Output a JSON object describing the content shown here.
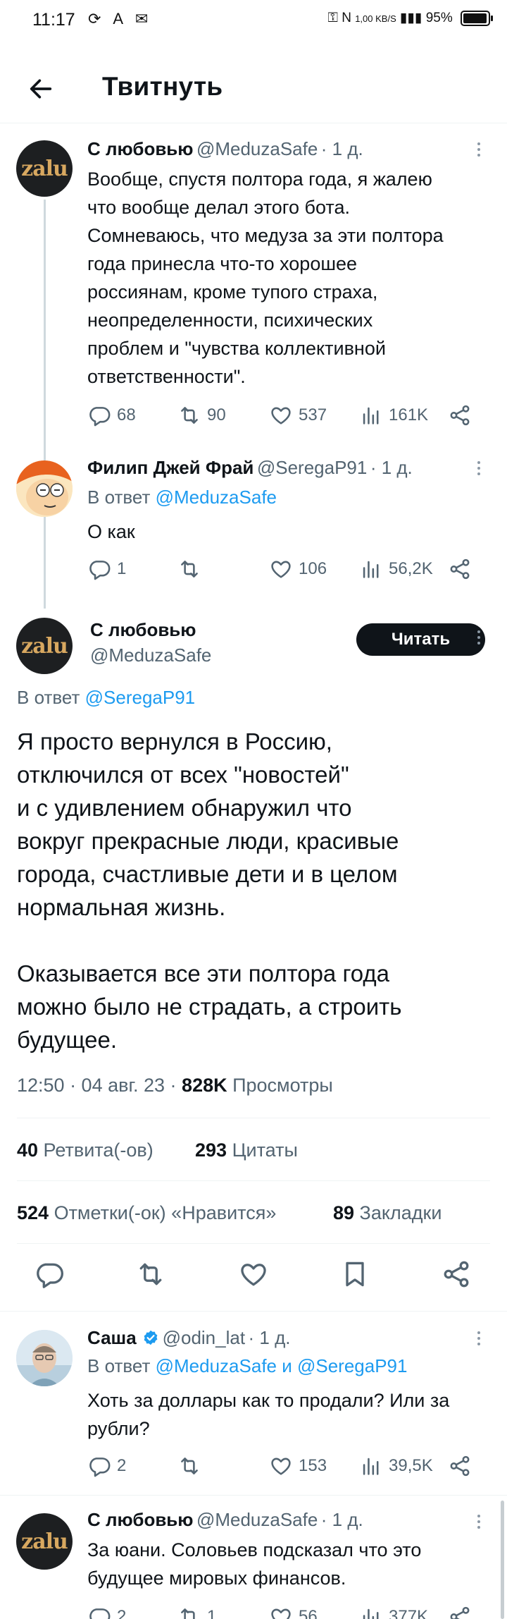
{
  "status_bar": {
    "time": "11:17",
    "speed": "1,00 KB/S",
    "battery": "95%"
  },
  "header": {
    "title": "Твитнуть"
  },
  "tweets": [
    {
      "name": "С любовью",
      "handle": "@MeduzaSafe",
      "time": "· 1 д.",
      "avatar_text": "zalu",
      "text": "Вообще, спустя полтора года, я жалею\nчто вообще делал этого бота.\nСомневаюсь, что медуза за эти полтора\nгода принесла что-то хорошее\nроссиянам, кроме тупого страха,\nнеопределенности, психических\nпроблем и \"чувства коллективной\nответственности\".",
      "replies": "68",
      "retweets": "90",
      "likes": "537",
      "views": "161K"
    },
    {
      "name": "Филип Джей Фрай",
      "handle": "@SeregaP91",
      "time": "· 1 д.",
      "reply_prefix": "В ответ ",
      "reply_to": "@MeduzaSafe",
      "text": "О как",
      "replies": "1",
      "retweets": "",
      "likes": "106",
      "views": "56,2K"
    }
  ],
  "main_tweet": {
    "name": "С любовью",
    "handle": "@MeduzaSafe",
    "avatar_text": "zalu",
    "follow_label": "Читать",
    "reply_prefix": "В ответ ",
    "reply_to": "@SeregaP91",
    "text": "Я просто вернулся в Россию,\nотключился от всех \"новостей\"\nи с удивлением обнаружил что\nвокруг прекрасные люди, красивые\nгорода, счастливые дети и в целом\nнормальная жизнь.\n\nОказывается все эти полтора года\nможно было не страдать, а строить\nбудущее.",
    "timestamp": "12:50 · 04 авг. 23 · ",
    "views_count": "828K",
    "views_label": " Просмотры",
    "retweets_count": "40",
    "retweets_label": " Ретвита(-ов)",
    "quotes_count": "293",
    "quotes_label": " Цитаты",
    "likes_count": "524",
    "likes_label": " Отметки(-ок) «Нравится»",
    "bookmarks_count": "89",
    "bookmarks_label": " Закладки"
  },
  "replies": [
    {
      "name": "Саша",
      "handle": "@odin_lat",
      "time": "· 1 д.",
      "reply_prefix": "В ответ ",
      "reply_to": "@MeduzaSafe и @SeregaP91",
      "text": "Хоть за доллары как то продали? Или за\nрубли?",
      "replies": "2",
      "retweets": "",
      "likes": "153",
      "views": "39,5K"
    },
    {
      "name": "С любовью",
      "handle": "@MeduzaSafe",
      "time": "· 1 д.",
      "avatar_text": "zalu",
      "text": "За юани. Соловьев подсказал что это\nбудущее мировых финансов.",
      "replies": "2",
      "retweets": "1",
      "likes": "56",
      "views": "377K"
    }
  ],
  "colors": {
    "link": "#1d9bf0",
    "secondary": "#536471",
    "verified": "#1d9bf0"
  },
  "icons": [
    "back-arrow-icon",
    "reply-icon",
    "retweet-icon",
    "like-icon",
    "views-icon",
    "share-icon",
    "bookmark-icon",
    "more-icon",
    "verified-icon"
  ]
}
